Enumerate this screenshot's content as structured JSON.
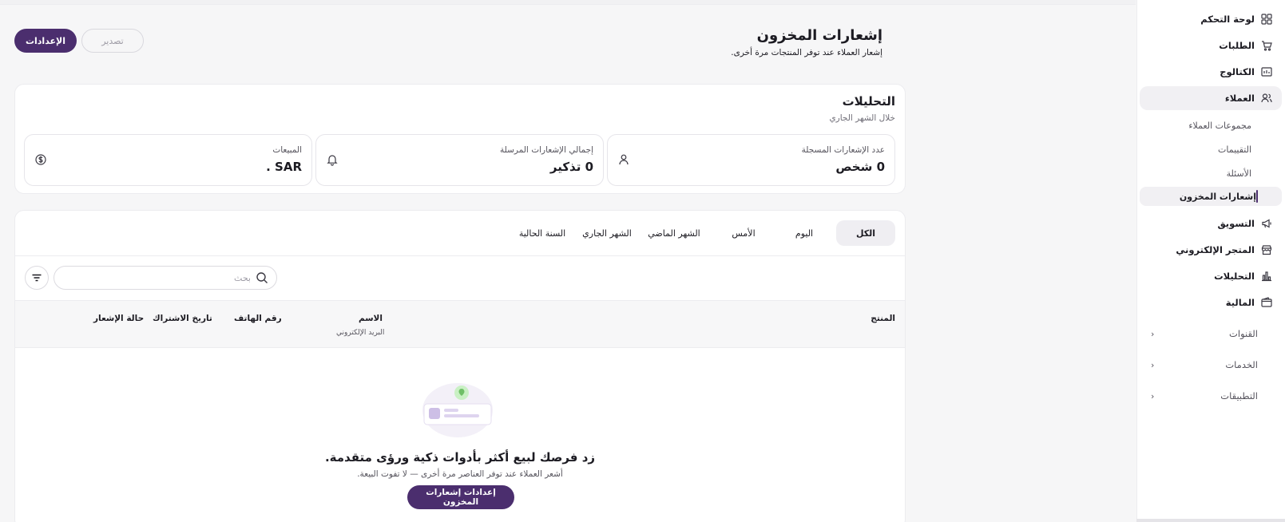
{
  "sidebar": {
    "items": [
      {
        "label": "لوحة التحكم",
        "icon": "dashboard-icon"
      },
      {
        "label": "الطلبات",
        "icon": "cart-icon"
      },
      {
        "label": "الكتالوج",
        "icon": "catalog-icon"
      },
      {
        "label": "العملاء",
        "icon": "users-icon"
      },
      {
        "label": "التسويق",
        "icon": "megaphone-icon"
      },
      {
        "label": "المتجر الإلكتروني",
        "icon": "store-icon"
      },
      {
        "label": "التحليلات",
        "icon": "chart-icon"
      },
      {
        "label": "المالية",
        "icon": "wallet-icon"
      }
    ],
    "customers_sub": [
      {
        "label": "مجموعات العملاء"
      },
      {
        "label": "التقييمات"
      },
      {
        "label": "الأسئلة"
      },
      {
        "label": "إشعارات المخزون"
      }
    ],
    "groups": [
      {
        "label": "القنوات"
      },
      {
        "label": "الخدمات"
      },
      {
        "label": "التطبيقات"
      }
    ]
  },
  "header": {
    "title": "إشعارات المخزون",
    "subtitle": "إشعار العملاء عند توفر المنتجات مرة أخرى.",
    "settings_label": "الإعدادات",
    "export_label": "تصدير"
  },
  "analytics": {
    "title": "التحليلات",
    "subtitle": "خلال الشهر الجاري",
    "stats": [
      {
        "label": "عدد الإشعارات المسجلة",
        "value": "0 شخص",
        "icon": "person-icon"
      },
      {
        "label": "إجمالي الإشعارات المرسلة",
        "value": "0 تذكير",
        "icon": "bell-icon"
      },
      {
        "label": "المبيعات",
        "value": "SAR .",
        "icon": "dollar-circle-icon"
      }
    ]
  },
  "tabs": [
    "الكل",
    "اليوم",
    "الأمس",
    "الشهر الماضي",
    "الشهر الجاري",
    "السنة الحالية"
  ],
  "search": {
    "placeholder": "بحث"
  },
  "table": {
    "columns": {
      "product": "المنتج",
      "name": "الاسم",
      "email": "البريد الإلكتروني",
      "phone": "رقم الهاتف",
      "subscribed": "تاريخ الاشتراك",
      "status": "حالة الإشعار"
    }
  },
  "empty": {
    "title": "زد فرصك لبيع أكثر بأدوات ذكية ورؤى متقدمة.",
    "subtitle": "أشعر العملاء عند توفر العناصر مرة أخرى — لا تفوت البيعة.",
    "button": "إعدادات إشعارات المخزون"
  },
  "colors": {
    "primary": "#4b2e6e",
    "background": "#f6f6f7",
    "card": "#ffffff"
  }
}
